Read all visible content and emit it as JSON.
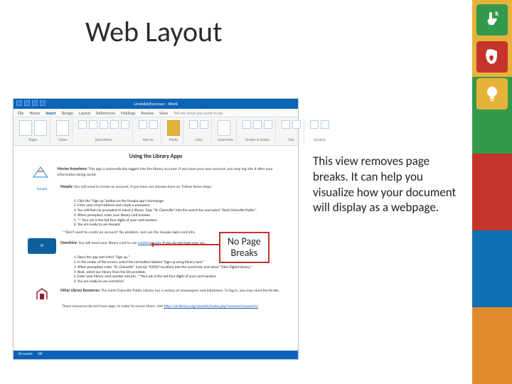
{
  "colors": {
    "strip": [
      "#e7b23a",
      "#329a4a",
      "#c4342a",
      "#0f6fb0",
      "#e08a2e"
    ],
    "accent_red": "#c4342a",
    "word_blue": "#0a63b6"
  },
  "icons": {
    "badge1_bg": "#329a4a",
    "badge2_bg": "#c4342a",
    "badge3_bg": "#e7b23a",
    "badge1_name": "touch-icon",
    "badge2_name": "ohio-icon",
    "badge3_name": "lightbulb-icon"
  },
  "title": "Web Layout",
  "body_text": "This view removes page breaks.  It can help you visualize how your document will display as a webpage.",
  "callout": {
    "line1": "No Page",
    "line2": "Breaks"
  },
  "word": {
    "titlebar": "LendableEaccesor - Word",
    "tabs": [
      "File",
      "Home",
      "Insert",
      "Design",
      "Layout",
      "References",
      "Mailings",
      "Review",
      "View",
      "Tell me what you want to do"
    ],
    "active_tab_index": 2,
    "ribbon_labels": [
      "Pages",
      "Tables",
      "Illustrations",
      "Add-ins",
      "Media",
      "Links",
      "Comments",
      "Header & Footer",
      "Text",
      "Symbols"
    ],
    "doc": {
      "heading": "Using the Library Apps",
      "movies_label": "Movies Anywhere:",
      "movies_text": " This app is automatically logged into the library account. If you have your own account, you may log into it after your information being saved.",
      "hoopla_label": "Hoopla:",
      "hoopla_text": " You will need to create an account, if you have not already done so. Follow these steps:",
      "hoopla_steps": [
        "Click the \"Sign up\" button on the Hoopla app's homepage.",
        "Enter your email address and create a password.",
        "You will then be prompted to select a library. Type \"St. Clairsville\" into the search bar and select \"Saint Clairsville Public\".",
        "When prompted, enter your library card number.",
        "** Your pin is the last four digits of your card number.",
        "You are ready to use Hoopla!"
      ],
      "hoopla_note": "**Don't want to create an account? No problem. Just use the Hoopla login card info.",
      "overdrive_label": "Overdrive:",
      "overdrive_text": " You will need your library card to use ",
      "overdrive_link": "overdrive.com",
      "overdrive_text2": ". If you do not have one, an...",
      "overdrive_steps": [
        "Open the app and select \"Sign up.\"",
        "In the center of the screen, select the red button labeled \"Sign up using library card.\"",
        "When prompted, enter \"St. Clairsville\" (not zip \"43950\" location) into the search bar and select \"Ohio Digital Library.\"",
        "Next, select our library from the list provided.",
        "Enter your library card number and pin. **Your pin is the last four digits of your card number.",
        "You are ready to use overdrive!"
      ],
      "other_label": "Other Library Resources:",
      "other_text": " The Saint Clairsville Public Library has a variety of newspapers and databases. To log in, you may need the Kindle.",
      "footer_text": "These resources do not have apps. In order to access them, visit ",
      "footer_link": "http://stclibrary.org/newsite/index.php?research/research/",
      "status_words": "36 words",
      "status_page": "DE"
    }
  }
}
